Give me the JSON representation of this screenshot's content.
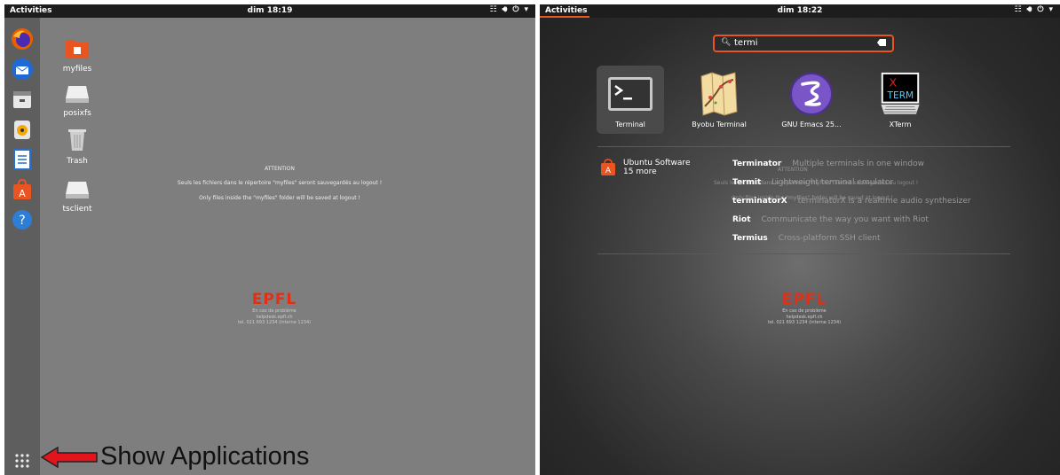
{
  "left": {
    "topbar": {
      "activities": "Activities",
      "clock": "dim 18:19"
    },
    "dock_icons": [
      "firefox-icon",
      "thunderbird-icon",
      "files-icon",
      "rhythmbox-icon",
      "libreoffice-writer-icon",
      "ubuntu-software-icon",
      "help-icon",
      "show-applications-icon"
    ],
    "desktop_icons": [
      {
        "label": "myfiles",
        "icon": "folder-icon"
      },
      {
        "label": "posixfs",
        "icon": "drive-icon"
      },
      {
        "label": "Trash",
        "icon": "trash-icon"
      },
      {
        "label": "tsclient",
        "icon": "drive-icon"
      }
    ],
    "notice": {
      "title": "ATTENTION",
      "line_fr": "Seuls les fichiers dans le répertoire \"myfiles\" seront sauvegardés au logout !",
      "line_en": "Only files inside the \"myfiles\" folder will be saved at logout !"
    },
    "logo": {
      "text": "EPFL",
      "line1": "En cas de problème",
      "line2": "helpdesk.epfl.ch",
      "line3": "tel. 021 693 1234 (interne 1234)"
    },
    "annotation": {
      "label": "Show Applications",
      "arrow_color": "#e3141b"
    }
  },
  "right": {
    "topbar": {
      "activities": "Activities",
      "clock": "dim 18:22"
    },
    "search": {
      "query": "termi"
    },
    "apps": [
      {
        "label": "Terminal",
        "icon": "terminal-icon",
        "selected": true
      },
      {
        "label": "Byobu Terminal",
        "icon": "byobu-icon",
        "selected": false
      },
      {
        "label": "GNU Emacs 25...",
        "icon": "emacs-icon",
        "selected": false
      },
      {
        "label": "XTerm",
        "icon": "xterm-icon",
        "selected": false
      }
    ],
    "provider": {
      "name": "Ubuntu Software",
      "more": "15 more"
    },
    "results": [
      {
        "name": "Terminator",
        "desc": "Multiple terminals in one window"
      },
      {
        "name": "Termit",
        "desc": "Lightweight terminal emulator"
      },
      {
        "name": "terminatorX",
        "desc": "terminatorX is a realtime audio synthesizer"
      },
      {
        "name": "Riot",
        "desc": "Communicate the way you want with Riot"
      },
      {
        "name": "Termius",
        "desc": "Cross-platform SSH client"
      }
    ],
    "logo": {
      "text": "EPFL",
      "line1": "En cas de problème",
      "line2": "helpdesk.epfl.ch",
      "line3": "tel. 021 693 1234 (interne 1234)"
    },
    "accent": "#e95420"
  }
}
